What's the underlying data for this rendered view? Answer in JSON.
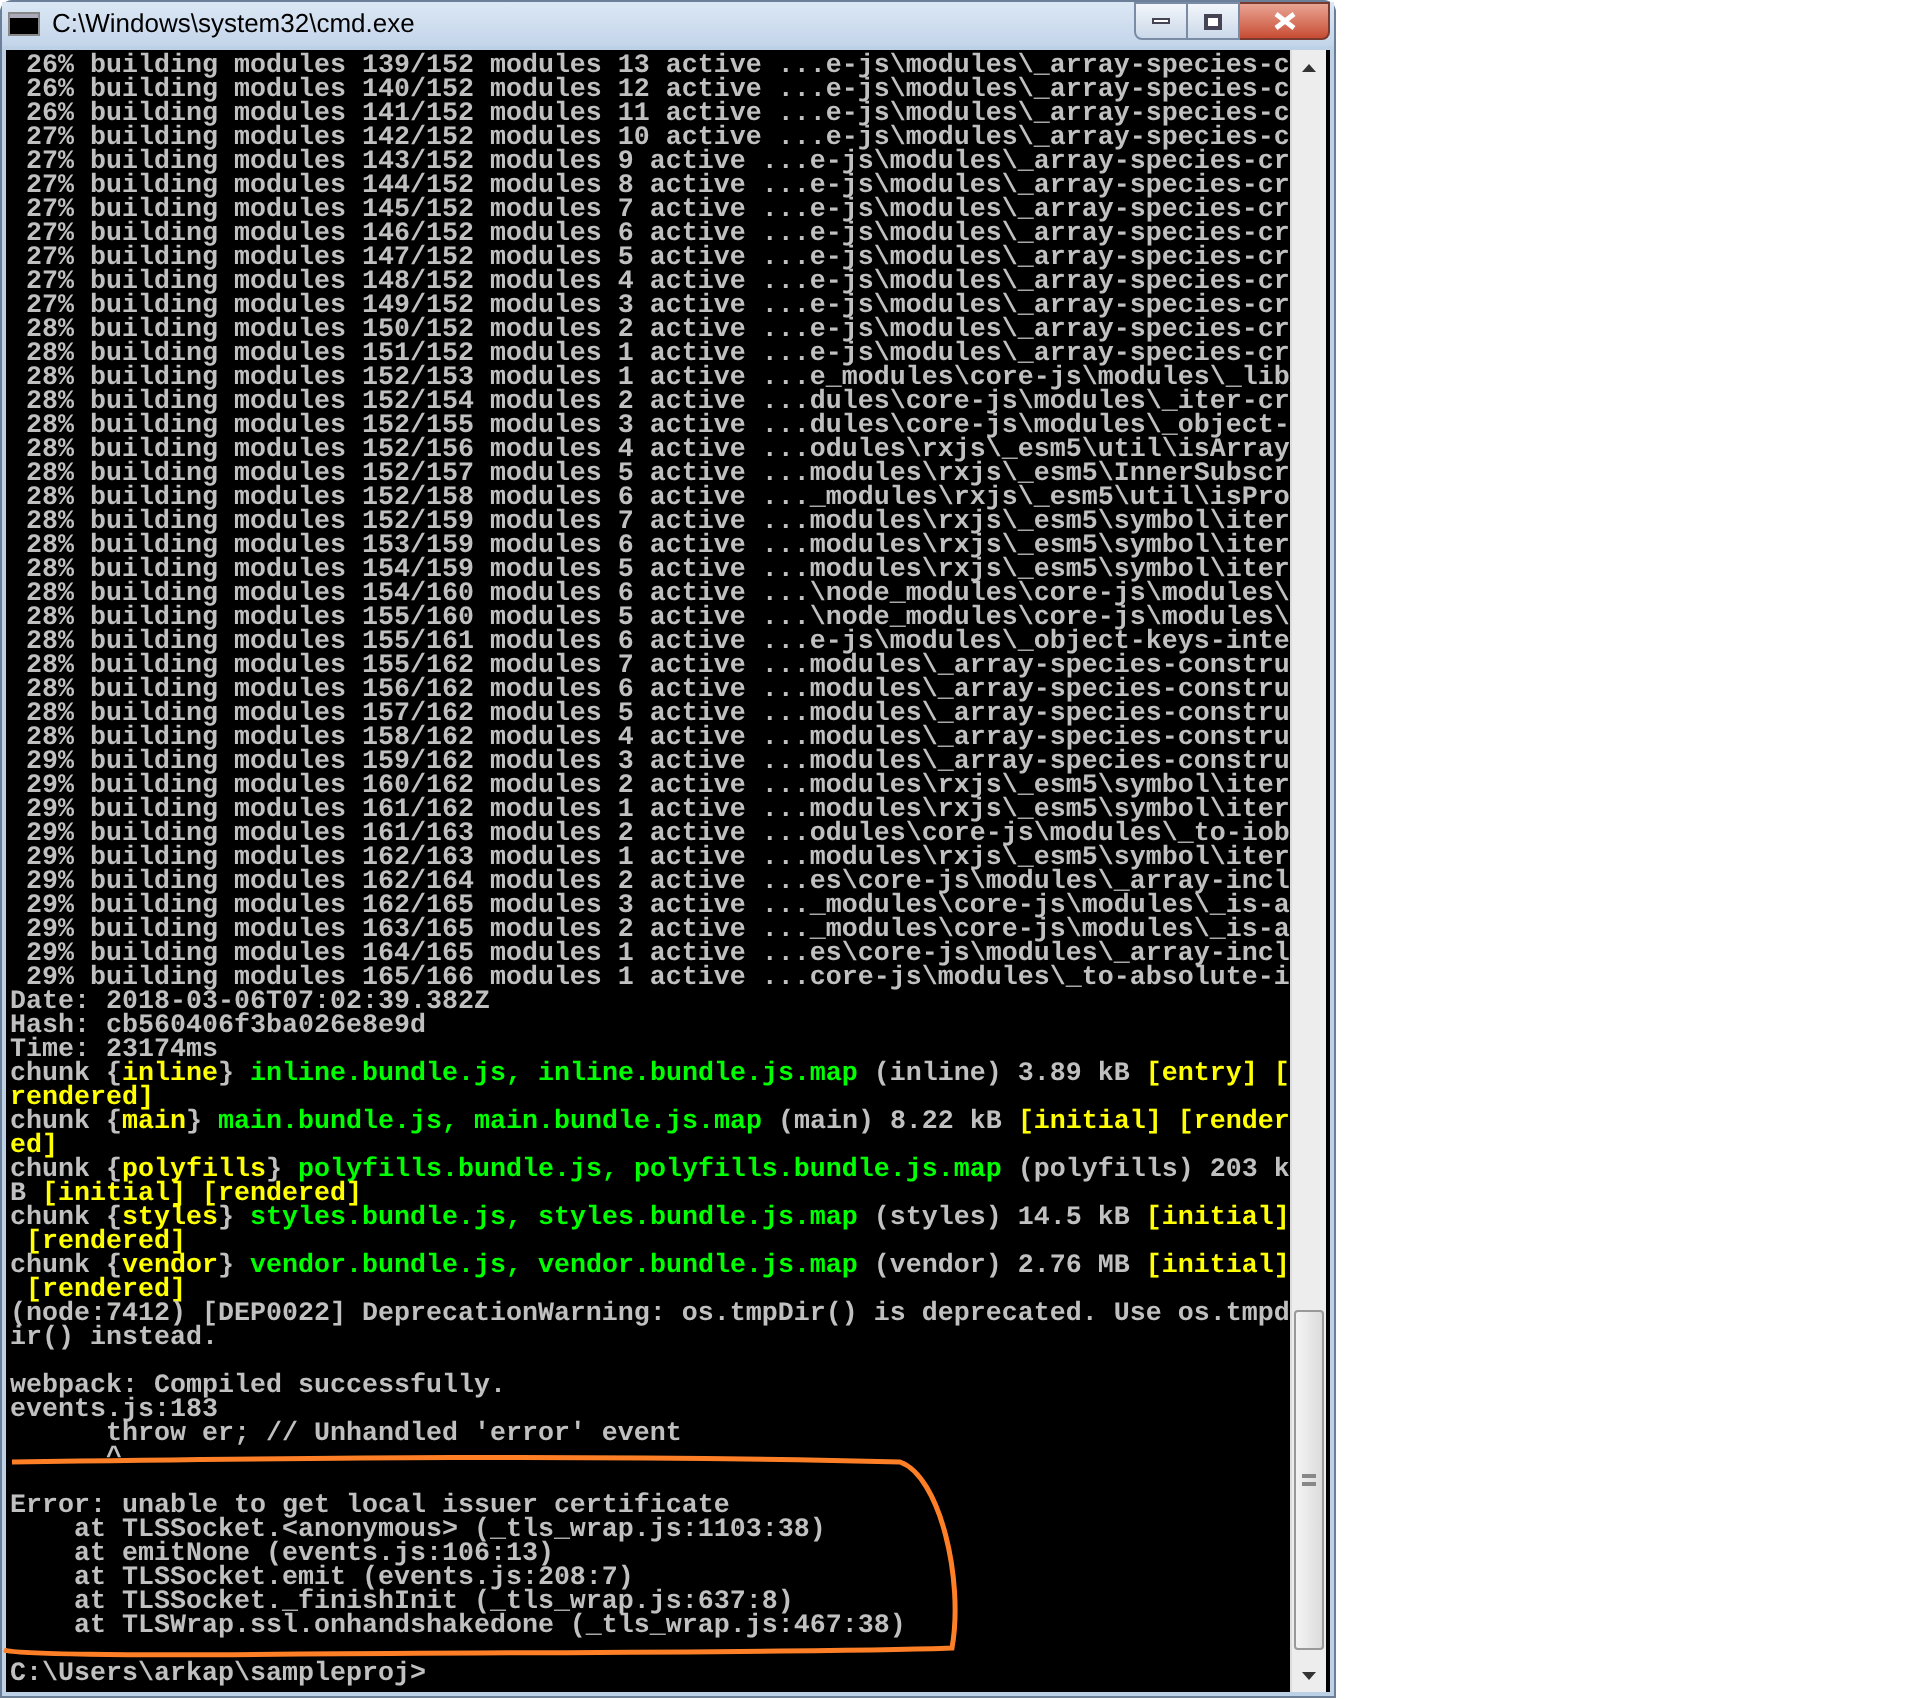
{
  "window": {
    "title": "C:\\Windows\\system32\\cmd.exe"
  },
  "console": {
    "lines": [
      {
        "kind": "text",
        "text": " 26% building modules 139/152 modules 13 active ...e-js\\modules\\_array-species-c"
      },
      {
        "kind": "text",
        "text": " 26% building modules 140/152 modules 12 active ...e-js\\modules\\_array-species-c"
      },
      {
        "kind": "text",
        "text": " 26% building modules 141/152 modules 11 active ...e-js\\modules\\_array-species-c"
      },
      {
        "kind": "text",
        "text": " 27% building modules 142/152 modules 10 active ...e-js\\modules\\_array-species-c"
      },
      {
        "kind": "text",
        "text": " 27% building modules 143/152 modules 9 active ...e-js\\modules\\_array-species-cr"
      },
      {
        "kind": "text",
        "text": " 27% building modules 144/152 modules 8 active ...e-js\\modules\\_array-species-cr"
      },
      {
        "kind": "text",
        "text": " 27% building modules 145/152 modules 7 active ...e-js\\modules\\_array-species-cr"
      },
      {
        "kind": "text",
        "text": " 27% building modules 146/152 modules 6 active ...e-js\\modules\\_array-species-cr"
      },
      {
        "kind": "text",
        "text": " 27% building modules 147/152 modules 5 active ...e-js\\modules\\_array-species-cr"
      },
      {
        "kind": "text",
        "text": " 27% building modules 148/152 modules 4 active ...e-js\\modules\\_array-species-cr"
      },
      {
        "kind": "text",
        "text": " 27% building modules 149/152 modules 3 active ...e-js\\modules\\_array-species-cr"
      },
      {
        "kind": "text",
        "text": " 28% building modules 150/152 modules 2 active ...e-js\\modules\\_array-species-cr"
      },
      {
        "kind": "text",
        "text": " 28% building modules 151/152 modules 1 active ...e-js\\modules\\_array-species-cr"
      },
      {
        "kind": "text",
        "text": " 28% building modules 152/153 modules 1 active ...e_modules\\core-js\\modules\\_lib"
      },
      {
        "kind": "text",
        "text": " 28% building modules 152/154 modules 2 active ...dules\\core-js\\modules\\_iter-cr"
      },
      {
        "kind": "text",
        "text": " 28% building modules 152/155 modules 3 active ...dules\\core-js\\modules\\_object-"
      },
      {
        "kind": "text",
        "text": " 28% building modules 152/156 modules 4 active ...odules\\rxjs\\_esm5\\util\\isArray"
      },
      {
        "kind": "text",
        "text": " 28% building modules 152/157 modules 5 active ...modules\\rxjs\\_esm5\\InnerSubscr"
      },
      {
        "kind": "text",
        "text": " 28% building modules 152/158 modules 6 active ..._modules\\rxjs\\_esm5\\util\\isPro"
      },
      {
        "kind": "text",
        "text": " 28% building modules 152/159 modules 7 active ...modules\\rxjs\\_esm5\\symbol\\iter"
      },
      {
        "kind": "text",
        "text": " 28% building modules 153/159 modules 6 active ...modules\\rxjs\\_esm5\\symbol\\iter"
      },
      {
        "kind": "text",
        "text": " 28% building modules 154/159 modules 5 active ...modules\\rxjs\\_esm5\\symbol\\iter"
      },
      {
        "kind": "text",
        "text": " 28% building modules 154/160 modules 6 active ...\\node_modules\\core-js\\modules\\"
      },
      {
        "kind": "text",
        "text": " 28% building modules 155/160 modules 5 active ...\\node_modules\\core-js\\modules\\"
      },
      {
        "kind": "text",
        "text": " 28% building modules 155/161 modules 6 active ...e-js\\modules\\_object-keys-inte"
      },
      {
        "kind": "text",
        "text": " 28% building modules 155/162 modules 7 active ...modules\\_array-species-constru"
      },
      {
        "kind": "text",
        "text": " 28% building modules 156/162 modules 6 active ...modules\\_array-species-constru"
      },
      {
        "kind": "text",
        "text": " 28% building modules 157/162 modules 5 active ...modules\\_array-species-constru"
      },
      {
        "kind": "text",
        "text": " 28% building modules 158/162 modules 4 active ...modules\\_array-species-constru"
      },
      {
        "kind": "text",
        "text": " 29% building modules 159/162 modules 3 active ...modules\\_array-species-constru"
      },
      {
        "kind": "text",
        "text": " 29% building modules 160/162 modules 2 active ...modules\\rxjs\\_esm5\\symbol\\iter"
      },
      {
        "kind": "text",
        "text": " 29% building modules 161/162 modules 1 active ...modules\\rxjs\\_esm5\\symbol\\iter"
      },
      {
        "kind": "text",
        "text": " 29% building modules 161/163 modules 2 active ...odules\\core-js\\modules\\_to-iob"
      },
      {
        "kind": "text",
        "text": " 29% building modules 162/163 modules 1 active ...modules\\rxjs\\_esm5\\symbol\\iter"
      },
      {
        "kind": "text",
        "text": " 29% building modules 162/164 modules 2 active ...es\\core-js\\modules\\_array-incl"
      },
      {
        "kind": "text",
        "text": " 29% building modules 162/165 modules 3 active ..._modules\\core-js\\modules\\_is-a"
      },
      {
        "kind": "text",
        "text": " 29% building modules 163/165 modules 2 active ..._modules\\core-js\\modules\\_is-a"
      },
      {
        "kind": "text",
        "text": " 29% building modules 164/165 modules 1 active ...es\\core-js\\modules\\_array-incl"
      },
      {
        "kind": "text",
        "text": " 29% building modules 165/166 modules 1 active ...core-js\\modules\\_to-absolute-i"
      },
      {
        "kind": "text",
        "text": "Date: 2018-03-06T07:02:39.382Z"
      },
      {
        "kind": "text",
        "text": "Hash: cb560406f3ba026e8e9d"
      },
      {
        "kind": "text",
        "text": "Time: 23174ms"
      },
      {
        "kind": "colored",
        "segments": [
          {
            "kind": "plain",
            "text": "chunk {"
          },
          {
            "kind": "name",
            "text": "inline"
          },
          {
            "kind": "plain",
            "text": "} "
          },
          {
            "kind": "file",
            "text": "inline.bundle.js, inline.bundle.js.map"
          },
          {
            "kind": "plain",
            "text": " (inline) 3.89 kB "
          },
          {
            "kind": "flag",
            "text": "[entry] ["
          }
        ]
      },
      {
        "kind": "colored",
        "segments": [
          {
            "kind": "flag",
            "text": "rendered]"
          }
        ]
      },
      {
        "kind": "colored",
        "segments": [
          {
            "kind": "plain",
            "text": "chunk {"
          },
          {
            "kind": "name",
            "text": "main"
          },
          {
            "kind": "plain",
            "text": "} "
          },
          {
            "kind": "file",
            "text": "main.bundle.js, main.bundle.js.map"
          },
          {
            "kind": "plain",
            "text": " (main) 8.22 kB "
          },
          {
            "kind": "flag",
            "text": "[initial] [render"
          }
        ]
      },
      {
        "kind": "colored",
        "segments": [
          {
            "kind": "flag",
            "text": "ed]"
          }
        ]
      },
      {
        "kind": "colored",
        "segments": [
          {
            "kind": "plain",
            "text": "chunk {"
          },
          {
            "kind": "name",
            "text": "polyfills"
          },
          {
            "kind": "plain",
            "text": "} "
          },
          {
            "kind": "file",
            "text": "polyfills.bundle.js, polyfills.bundle.js.map"
          },
          {
            "kind": "plain",
            "text": " (polyfills) 203 k"
          }
        ]
      },
      {
        "kind": "colored",
        "segments": [
          {
            "kind": "plain",
            "text": "B "
          },
          {
            "kind": "flag",
            "text": "[initial] [rendered]"
          }
        ]
      },
      {
        "kind": "colored",
        "segments": [
          {
            "kind": "plain",
            "text": "chunk {"
          },
          {
            "kind": "name",
            "text": "styles"
          },
          {
            "kind": "plain",
            "text": "} "
          },
          {
            "kind": "file",
            "text": "styles.bundle.js, styles.bundle.js.map"
          },
          {
            "kind": "plain",
            "text": " (styles) 14.5 kB "
          },
          {
            "kind": "flag",
            "text": "[initial]"
          }
        ]
      },
      {
        "kind": "colored",
        "segments": [
          {
            "kind": "flag",
            "text": " [rendered]"
          }
        ]
      },
      {
        "kind": "colored",
        "segments": [
          {
            "kind": "plain",
            "text": "chunk {"
          },
          {
            "kind": "name",
            "text": "vendor"
          },
          {
            "kind": "plain",
            "text": "} "
          },
          {
            "kind": "file",
            "text": "vendor.bundle.js, vendor.bundle.js.map"
          },
          {
            "kind": "plain",
            "text": " (vendor) 2.76 MB "
          },
          {
            "kind": "flag",
            "text": "[initial]"
          }
        ]
      },
      {
        "kind": "colored",
        "segments": [
          {
            "kind": "flag",
            "text": " [rendered]"
          }
        ]
      },
      {
        "kind": "text",
        "text": "(node:7412) [DEP0022] DeprecationWarning: os.tmpDir() is deprecated. Use os.tmpd"
      },
      {
        "kind": "text",
        "text": "ir() instead."
      },
      {
        "kind": "blank"
      },
      {
        "kind": "text",
        "text": "webpack: Compiled successfully."
      },
      {
        "kind": "text",
        "text": "events.js:183"
      },
      {
        "kind": "text",
        "text": "      throw er; // Unhandled 'error' event"
      },
      {
        "kind": "text",
        "text": "      ^"
      },
      {
        "kind": "blank"
      },
      {
        "kind": "text",
        "text": "Error: unable to get local issuer certificate"
      },
      {
        "kind": "text",
        "text": "    at TLSSocket.<anonymous> (_tls_wrap.js:1103:38)"
      },
      {
        "kind": "text",
        "text": "    at emitNone (events.js:106:13)"
      },
      {
        "kind": "text",
        "text": "    at TLSSocket.emit (events.js:208:7)"
      },
      {
        "kind": "text",
        "text": "    at TLSSocket._finishInit (_tls_wrap.js:637:8)"
      },
      {
        "kind": "text",
        "text": "    at TLSWrap.ssl.onhandshakedone (_tls_wrap.js:467:38)"
      },
      {
        "kind": "blank"
      },
      {
        "kind": "text",
        "text": "C:\\Users\\arkap\\sampleproj>"
      }
    ]
  }
}
